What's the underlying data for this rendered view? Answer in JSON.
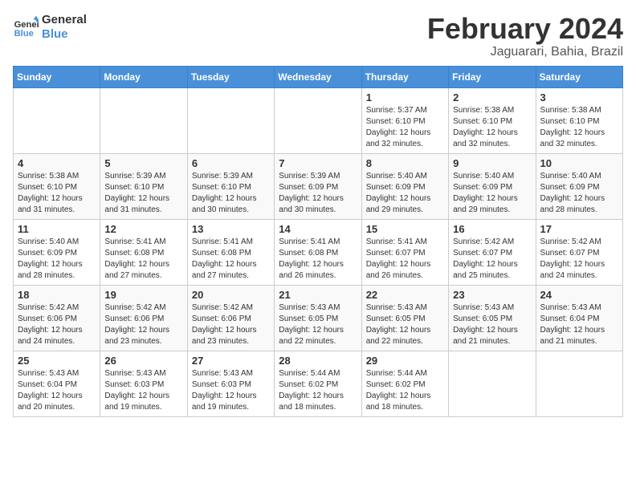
{
  "logo": {
    "text_general": "General",
    "text_blue": "Blue"
  },
  "title": "February 2024",
  "subtitle": "Jaguarari, Bahia, Brazil",
  "days_of_week": [
    "Sunday",
    "Monday",
    "Tuesday",
    "Wednesday",
    "Thursday",
    "Friday",
    "Saturday"
  ],
  "weeks": [
    [
      {
        "day": "",
        "info": ""
      },
      {
        "day": "",
        "info": ""
      },
      {
        "day": "",
        "info": ""
      },
      {
        "day": "",
        "info": ""
      },
      {
        "day": "1",
        "info": "Sunrise: 5:37 AM\nSunset: 6:10 PM\nDaylight: 12 hours\nand 32 minutes."
      },
      {
        "day": "2",
        "info": "Sunrise: 5:38 AM\nSunset: 6:10 PM\nDaylight: 12 hours\nand 32 minutes."
      },
      {
        "day": "3",
        "info": "Sunrise: 5:38 AM\nSunset: 6:10 PM\nDaylight: 12 hours\nand 32 minutes."
      }
    ],
    [
      {
        "day": "4",
        "info": "Sunrise: 5:38 AM\nSunset: 6:10 PM\nDaylight: 12 hours\nand 31 minutes."
      },
      {
        "day": "5",
        "info": "Sunrise: 5:39 AM\nSunset: 6:10 PM\nDaylight: 12 hours\nand 31 minutes."
      },
      {
        "day": "6",
        "info": "Sunrise: 5:39 AM\nSunset: 6:10 PM\nDaylight: 12 hours\nand 30 minutes."
      },
      {
        "day": "7",
        "info": "Sunrise: 5:39 AM\nSunset: 6:09 PM\nDaylight: 12 hours\nand 30 minutes."
      },
      {
        "day": "8",
        "info": "Sunrise: 5:40 AM\nSunset: 6:09 PM\nDaylight: 12 hours\nand 29 minutes."
      },
      {
        "day": "9",
        "info": "Sunrise: 5:40 AM\nSunset: 6:09 PM\nDaylight: 12 hours\nand 29 minutes."
      },
      {
        "day": "10",
        "info": "Sunrise: 5:40 AM\nSunset: 6:09 PM\nDaylight: 12 hours\nand 28 minutes."
      }
    ],
    [
      {
        "day": "11",
        "info": "Sunrise: 5:40 AM\nSunset: 6:09 PM\nDaylight: 12 hours\nand 28 minutes."
      },
      {
        "day": "12",
        "info": "Sunrise: 5:41 AM\nSunset: 6:08 PM\nDaylight: 12 hours\nand 27 minutes."
      },
      {
        "day": "13",
        "info": "Sunrise: 5:41 AM\nSunset: 6:08 PM\nDaylight: 12 hours\nand 27 minutes."
      },
      {
        "day": "14",
        "info": "Sunrise: 5:41 AM\nSunset: 6:08 PM\nDaylight: 12 hours\nand 26 minutes."
      },
      {
        "day": "15",
        "info": "Sunrise: 5:41 AM\nSunset: 6:07 PM\nDaylight: 12 hours\nand 26 minutes."
      },
      {
        "day": "16",
        "info": "Sunrise: 5:42 AM\nSunset: 6:07 PM\nDaylight: 12 hours\nand 25 minutes."
      },
      {
        "day": "17",
        "info": "Sunrise: 5:42 AM\nSunset: 6:07 PM\nDaylight: 12 hours\nand 24 minutes."
      }
    ],
    [
      {
        "day": "18",
        "info": "Sunrise: 5:42 AM\nSunset: 6:06 PM\nDaylight: 12 hours\nand 24 minutes."
      },
      {
        "day": "19",
        "info": "Sunrise: 5:42 AM\nSunset: 6:06 PM\nDaylight: 12 hours\nand 23 minutes."
      },
      {
        "day": "20",
        "info": "Sunrise: 5:42 AM\nSunset: 6:06 PM\nDaylight: 12 hours\nand 23 minutes."
      },
      {
        "day": "21",
        "info": "Sunrise: 5:43 AM\nSunset: 6:05 PM\nDaylight: 12 hours\nand 22 minutes."
      },
      {
        "day": "22",
        "info": "Sunrise: 5:43 AM\nSunset: 6:05 PM\nDaylight: 12 hours\nand 22 minutes."
      },
      {
        "day": "23",
        "info": "Sunrise: 5:43 AM\nSunset: 6:05 PM\nDaylight: 12 hours\nand 21 minutes."
      },
      {
        "day": "24",
        "info": "Sunrise: 5:43 AM\nSunset: 6:04 PM\nDaylight: 12 hours\nand 21 minutes."
      }
    ],
    [
      {
        "day": "25",
        "info": "Sunrise: 5:43 AM\nSunset: 6:04 PM\nDaylight: 12 hours\nand 20 minutes."
      },
      {
        "day": "26",
        "info": "Sunrise: 5:43 AM\nSunset: 6:03 PM\nDaylight: 12 hours\nand 19 minutes."
      },
      {
        "day": "27",
        "info": "Sunrise: 5:43 AM\nSunset: 6:03 PM\nDaylight: 12 hours\nand 19 minutes."
      },
      {
        "day": "28",
        "info": "Sunrise: 5:44 AM\nSunset: 6:02 PM\nDaylight: 12 hours\nand 18 minutes."
      },
      {
        "day": "29",
        "info": "Sunrise: 5:44 AM\nSunset: 6:02 PM\nDaylight: 12 hours\nand 18 minutes."
      },
      {
        "day": "",
        "info": ""
      },
      {
        "day": "",
        "info": ""
      }
    ]
  ]
}
